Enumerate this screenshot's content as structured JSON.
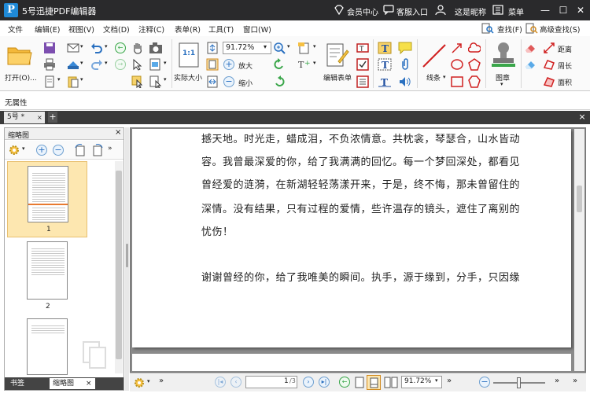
{
  "app": {
    "title": "5号迅捷PDF编辑器",
    "logo_letter": "P"
  },
  "titlebar": {
    "member": "会员中心",
    "support": "客服入口",
    "user": "这是昵称",
    "menu": "菜单"
  },
  "menu": [
    "文件",
    "编辑(E)",
    "视图(V)",
    "文档(D)",
    "注释(C)",
    "表单(R)",
    "工具(T)",
    "窗口(W)"
  ],
  "menu_right": {
    "find": "查找(F)",
    "advanced_find": "高级查找(S)"
  },
  "ribbon": {
    "open": "打开(O)...",
    "actual_size": "实际大小",
    "zoom_value": "91.72%",
    "zoom_in": "放大",
    "zoom_out": "缩小",
    "edit_form": "编辑表单",
    "line": "线条",
    "stamp": "图章",
    "distance": "距离",
    "perimeter": "周长",
    "area": "面积",
    "one_to_one": "1:1"
  },
  "props": {
    "label": "无属性"
  },
  "tabs": {
    "doc_tab": "5号 *",
    "add": "+",
    "close": "×"
  },
  "thumbnails": {
    "title": "缩略图",
    "close": "×",
    "pages": [
      {
        "label": "1"
      },
      {
        "label": "2"
      }
    ]
  },
  "left_bottom_tabs": {
    "bookmarks": "书签",
    "thumbnails": "缩略图",
    "close": "×"
  },
  "document": {
    "lines": [
      "撼天地。时光走，蜡成泪，不负浓情意。共枕衾，琴瑟合，山水皆动",
      "容。我曾最深爱的你，给了我满满的回忆。每一个梦回深处，都看见",
      "曾经爱的涟漪，在新湖轻轻荡漾开来，于是，终不悔，那未曾留住的",
      "深情。没有结果，只有过程的爱情，些许温存的镜头，遮住了离别的",
      "忧伤！",
      "谢谢曾经的你，给了我唯美的瞬间。执手，源于缘到，分手，只因缘"
    ]
  },
  "navbar": {
    "page_input": "1",
    "page_total": "/3",
    "zoom": "91.72%"
  },
  "colors": {
    "titlebar": "#2a2a2c",
    "accent": "#1f8ad8",
    "selected_thumb": "#fde7b0",
    "doc_bg": "#8a8a8a"
  }
}
